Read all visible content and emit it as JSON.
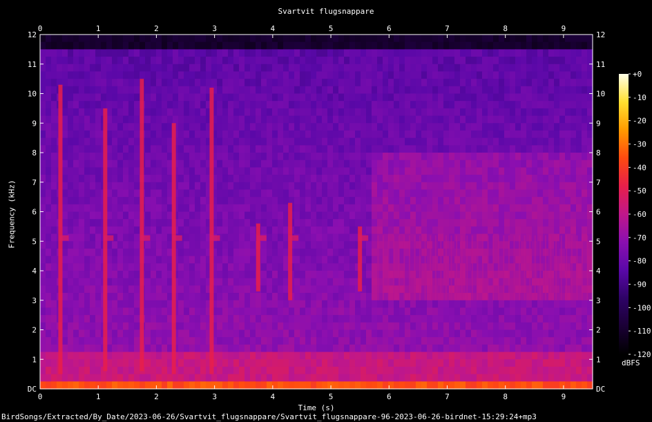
{
  "chart_data": {
    "type": "heatmap",
    "title": "Svartvit flugsnappare",
    "xlabel": "Time (s)",
    "ylabel": "Frequency (kHz)",
    "xlim": [
      0,
      9.5
    ],
    "ylim": [
      0,
      12
    ],
    "x_ticks": [
      "0",
      "1",
      "2",
      "3",
      "4",
      "5",
      "6",
      "7",
      "8",
      "9"
    ],
    "y_ticks": [
      "DC",
      "1",
      "2",
      "3",
      "4",
      "5",
      "6",
      "7",
      "8",
      "9",
      "10",
      "11",
      "12"
    ],
    "colorbar": {
      "unit": "dBFS",
      "ticks": [
        "+0",
        "-10",
        "-20",
        "-30",
        "-40",
        "-50",
        "-60",
        "-70",
        "-80",
        "-90",
        "-100",
        "-110",
        "-120"
      ],
      "range": [
        -120,
        0
      ]
    },
    "colormap": [
      "#000000",
      "#1a0035",
      "#2e0366",
      "#5a08a8",
      "#8a0fb0",
      "#c0178a",
      "#e81f4a",
      "#ff4a10",
      "#ff9a00",
      "#ffe030",
      "#ffffe8"
    ],
    "noise_floor_khz": 11.5,
    "notes_calls": [
      {
        "t": 0.35,
        "fmin": 0.5,
        "fmax": 10.3
      },
      {
        "t": 1.12,
        "fmin": 0.6,
        "fmax": 9.5
      },
      {
        "t": 1.75,
        "fmin": 0.6,
        "fmax": 10.5
      },
      {
        "t": 2.3,
        "fmin": 0.5,
        "fmax": 9.0
      },
      {
        "t": 2.95,
        "fmin": 0.5,
        "fmax": 10.2
      },
      {
        "t": 3.75,
        "fmin": 3.3,
        "fmax": 5.6
      },
      {
        "t": 4.3,
        "fmin": 3.0,
        "fmax": 6.3
      },
      {
        "t": 5.5,
        "fmin": 3.3,
        "fmax": 5.5
      }
    ]
  },
  "footer": {
    "filepath": "BirdSongs/Extracted/By_Date/2023-06-26/Svartvit_flugsnappare/Svartvit_flugsnappare-96-2023-06-26-birdnet-15:29:24+mp3"
  }
}
